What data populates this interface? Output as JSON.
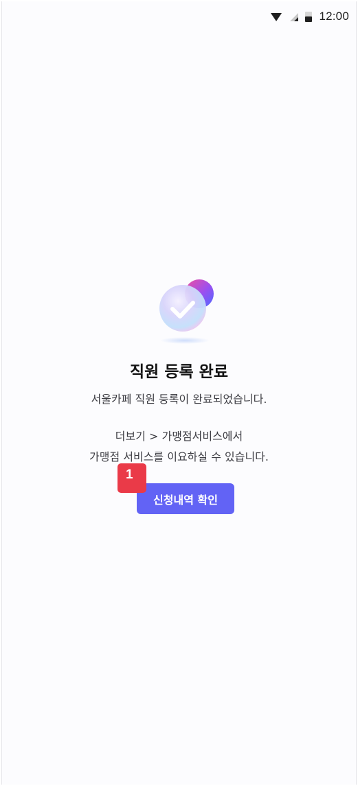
{
  "status_bar": {
    "time": "12:00",
    "icons": [
      "wifi-icon",
      "signal-icon",
      "battery-icon"
    ]
  },
  "completion": {
    "title": "직원 등록 완료",
    "subtitle": "서울카페 직원 등록이 완료되었습니다.",
    "guide_line_1": "더보기 >  가맹점서비스에서",
    "guide_line_2": "가맹점 서비스를 이요하실 수 있습니다.",
    "icon": "check-circle-icon"
  },
  "actions": {
    "confirm_label": "신청내역 확인"
  },
  "marker": {
    "label": "1"
  },
  "colors": {
    "primary": "#6263f5",
    "marker": "#ea3a48",
    "title_text": "#141414",
    "body_text": "#3e3e44"
  }
}
